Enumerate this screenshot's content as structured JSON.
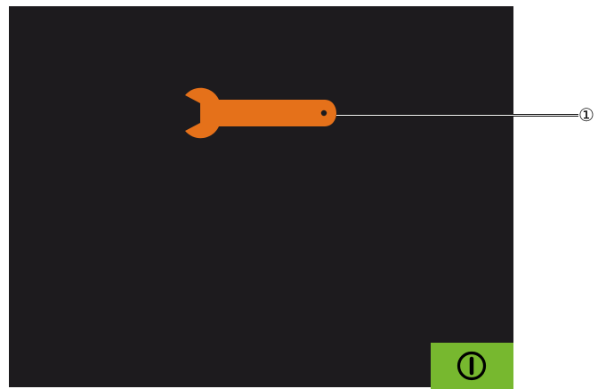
{
  "screen": {
    "background_color": "#1d1b1e"
  },
  "wrench": {
    "icon": "wrench-icon",
    "color": "#e5711a"
  },
  "callout": {
    "label": "①"
  },
  "power_button": {
    "icon": "power-icon",
    "color": "#77b82f"
  }
}
